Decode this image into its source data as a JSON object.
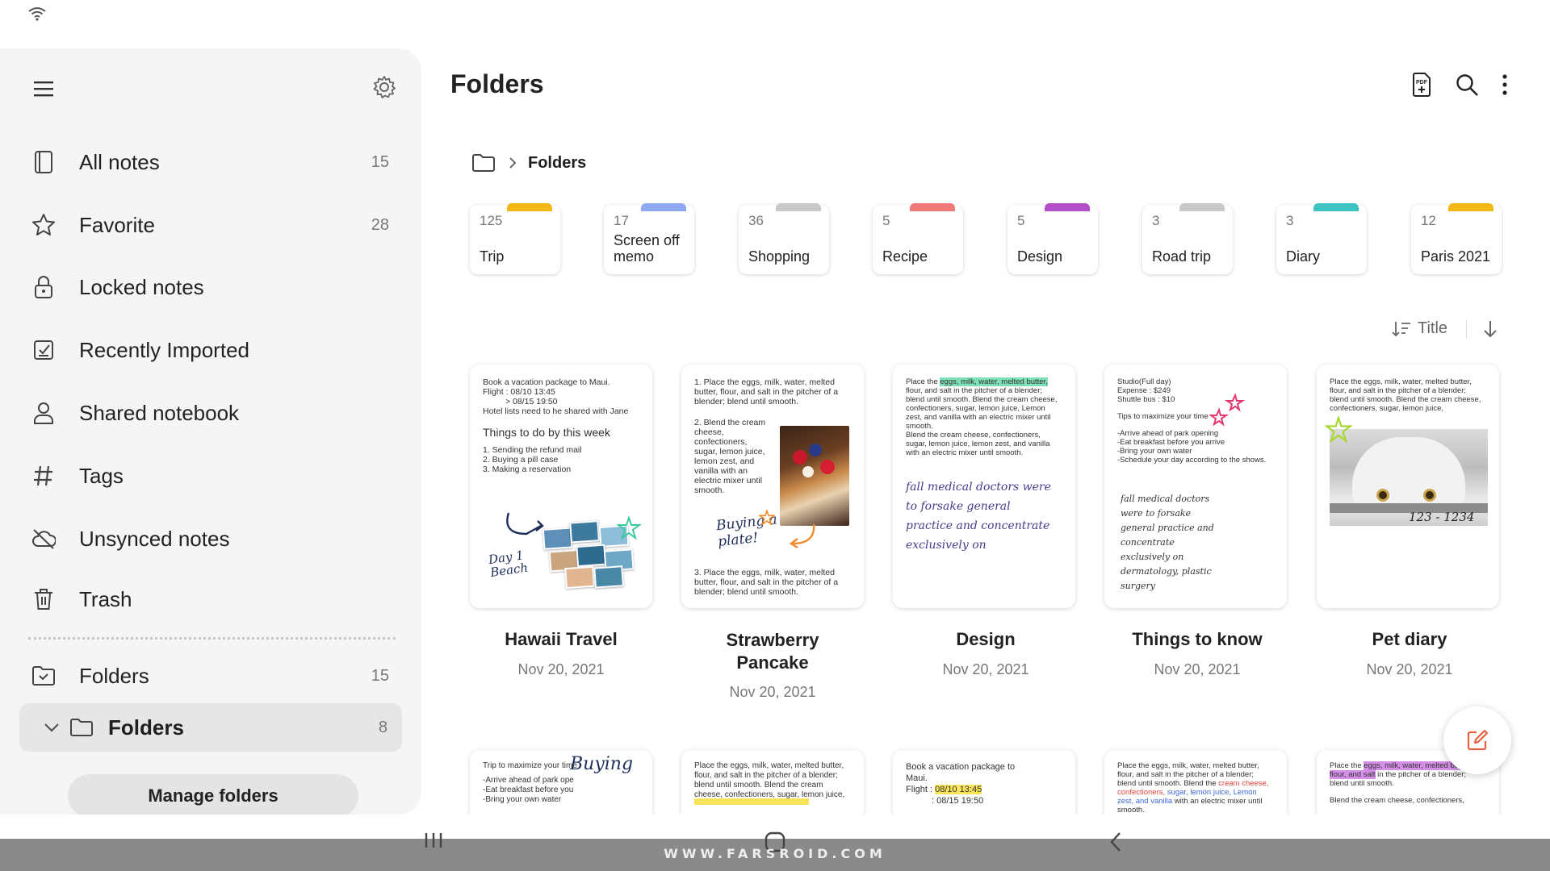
{
  "sidebar": {
    "items": [
      {
        "label": "All notes",
        "count": "15",
        "icon": "notebook-icon"
      },
      {
        "label": "Favorite",
        "count": "28",
        "icon": "star-icon"
      },
      {
        "label": "Locked notes",
        "count": "",
        "icon": "lock-icon"
      },
      {
        "label": "Recently Imported",
        "count": "",
        "icon": "import-icon"
      },
      {
        "label": "Shared notebook",
        "count": "",
        "icon": "person-icon"
      },
      {
        "label": "Tags",
        "count": "",
        "icon": "hash-icon"
      },
      {
        "label": "Unsynced notes",
        "count": "",
        "icon": "cloud-off-icon"
      },
      {
        "label": "Trash",
        "count": "",
        "icon": "trash-icon"
      }
    ],
    "folders": {
      "label": "Folders",
      "count": "15"
    },
    "sub_folder": {
      "label": "Folders",
      "count": "8"
    },
    "manage_label": "Manage folders"
  },
  "header": {
    "title": "Folders"
  },
  "breadcrumb": {
    "label": "Folders"
  },
  "folders": [
    {
      "count": "125",
      "name": "Trip",
      "color": "#f3b716"
    },
    {
      "count": "17",
      "name": "Screen off memo",
      "color": "#8fa8f2"
    },
    {
      "count": "36",
      "name": "Shopping",
      "color": "#c9c9c9"
    },
    {
      "count": "5",
      "name": "Recipe",
      "color": "#f07a7a"
    },
    {
      "count": "5",
      "name": "Design",
      "color": "#b44ec9"
    },
    {
      "count": "3",
      "name": "Road trip",
      "color": "#c9c9c9"
    },
    {
      "count": "3",
      "name": "Diary",
      "color": "#3fc2c2"
    },
    {
      "count": "12",
      "name": "Paris 2021",
      "color": "#f3b716"
    }
  ],
  "sort": {
    "label": "Title"
  },
  "notes": [
    {
      "title": "Hawaii Travel",
      "date": "Nov 20, 2021",
      "preview": {
        "line1": "Book a vacation package to Maui.",
        "line2": "Flight  : 08/10 13:45",
        "line3": "> 08/15 19:50",
        "line4": "Hotel lists need to he shared with Jane",
        "heading": "Things to do by this week",
        "todo1": "1. Sending the refund mail",
        "todo2": "2. Buying a pill case",
        "todo3": "3. Making a reservation",
        "hand": "Day 1 Beach"
      }
    },
    {
      "title": "Strawberry Pancake",
      "date": "Nov 20, 2021",
      "preview": {
        "step1": "1. Place the eggs, milk, water, melted butter, flour, and salt in the pitcher of a blender; blend until smooth.",
        "step2": "2. Blend the cream cheese, confectioners, sugar, lemon juice, lemon zest, and vanilla with an electric mixer until smooth.",
        "hand": "Buying a plate!",
        "step3": "3. Place the eggs, milk, water, melted butter, flour, and salt in the pitcher of a blender; blend until smooth."
      }
    },
    {
      "title": "Design",
      "date": "Nov 20, 2021",
      "preview": {
        "lead": "Place the",
        "highlight": "eggs, milk, water, melted butter,",
        "rest": "flour, and salt in the pitcher of a blender; blend until smooth. Blend the cream cheese, confectioners, sugar, lemon juice, Lemon zest, and vanilla with an electric mixer until smooth.",
        "para2": "Blend the cream cheese, confectioners, sugar, lemon juice, lemon zest, and vanilla with an electric mixer until smooth.",
        "hand": "fall medical doctors were to forsake general practice and concentrate exclusively on"
      }
    },
    {
      "title": "Things to know",
      "date": "Nov 20, 2021",
      "preview": {
        "line1": "Studio(Full day)",
        "line2": "Expense : $249",
        "line3": "Shuttle bus : $10",
        "line4": "Tips to maximize your time",
        "line5": "-Arrive ahead of park opening",
        "line6": "-Eat breakfast before you arrive",
        "line7": "-Bring your own water",
        "line8": "-Schedule your day according to the shows.",
        "hand": "fall medical doctors were to forsake general practice and concentrate exclusively on dermatology, plastic surgery"
      }
    },
    {
      "title": "Pet diary",
      "date": "Nov 20, 2021",
      "preview": {
        "text": "Place the eggs, milk, water, melted butter, flour, and salt in the pitcher of a blender; blend until smooth. Blend the cream cheese, confectioners, sugar, lemon juice,",
        "hand": "123 - 1234"
      }
    }
  ],
  "notes_row2": [
    {
      "line1": "Trip to maximize your time",
      "line2": "-Arrive ahead of park ope",
      "line3": "-Eat breakfast before you",
      "line4": "-Bring your own water",
      "hand": "Buying"
    },
    {
      "text": "Place the eggs, milk, water, melted butter, flour, and salt in the pitcher of a blender; blend until smooth. Blend the cream cheese, confectioners, sugar, lemon juice,"
    },
    {
      "line1": "Book a vacation package to",
      "line2": "Maui.",
      "flight_label": "Flight  :",
      "flight_val": "08/10 13:45",
      "line4": ": 08/15 19:50"
    },
    {
      "lead": "Place the eggs, milk, water, melted butter, flour, and salt in the pitcher of a blender; blend until smooth. Blend the",
      "red1": "cream cheese, confectioners,",
      "blue1": "sugar, lemon juice, Lemon zest, and vanilla",
      "rest": "with an electric mixer until smooth."
    },
    {
      "lead": "Place the",
      "hl": "eggs, milk, water, melted butter, flour, and salt",
      "rest": "in the pitcher of a blender; blend until smooth.",
      "line2": "Blend the cream cheese, confectioners,"
    }
  ],
  "watermark": "WWW.FARSROID.COM"
}
